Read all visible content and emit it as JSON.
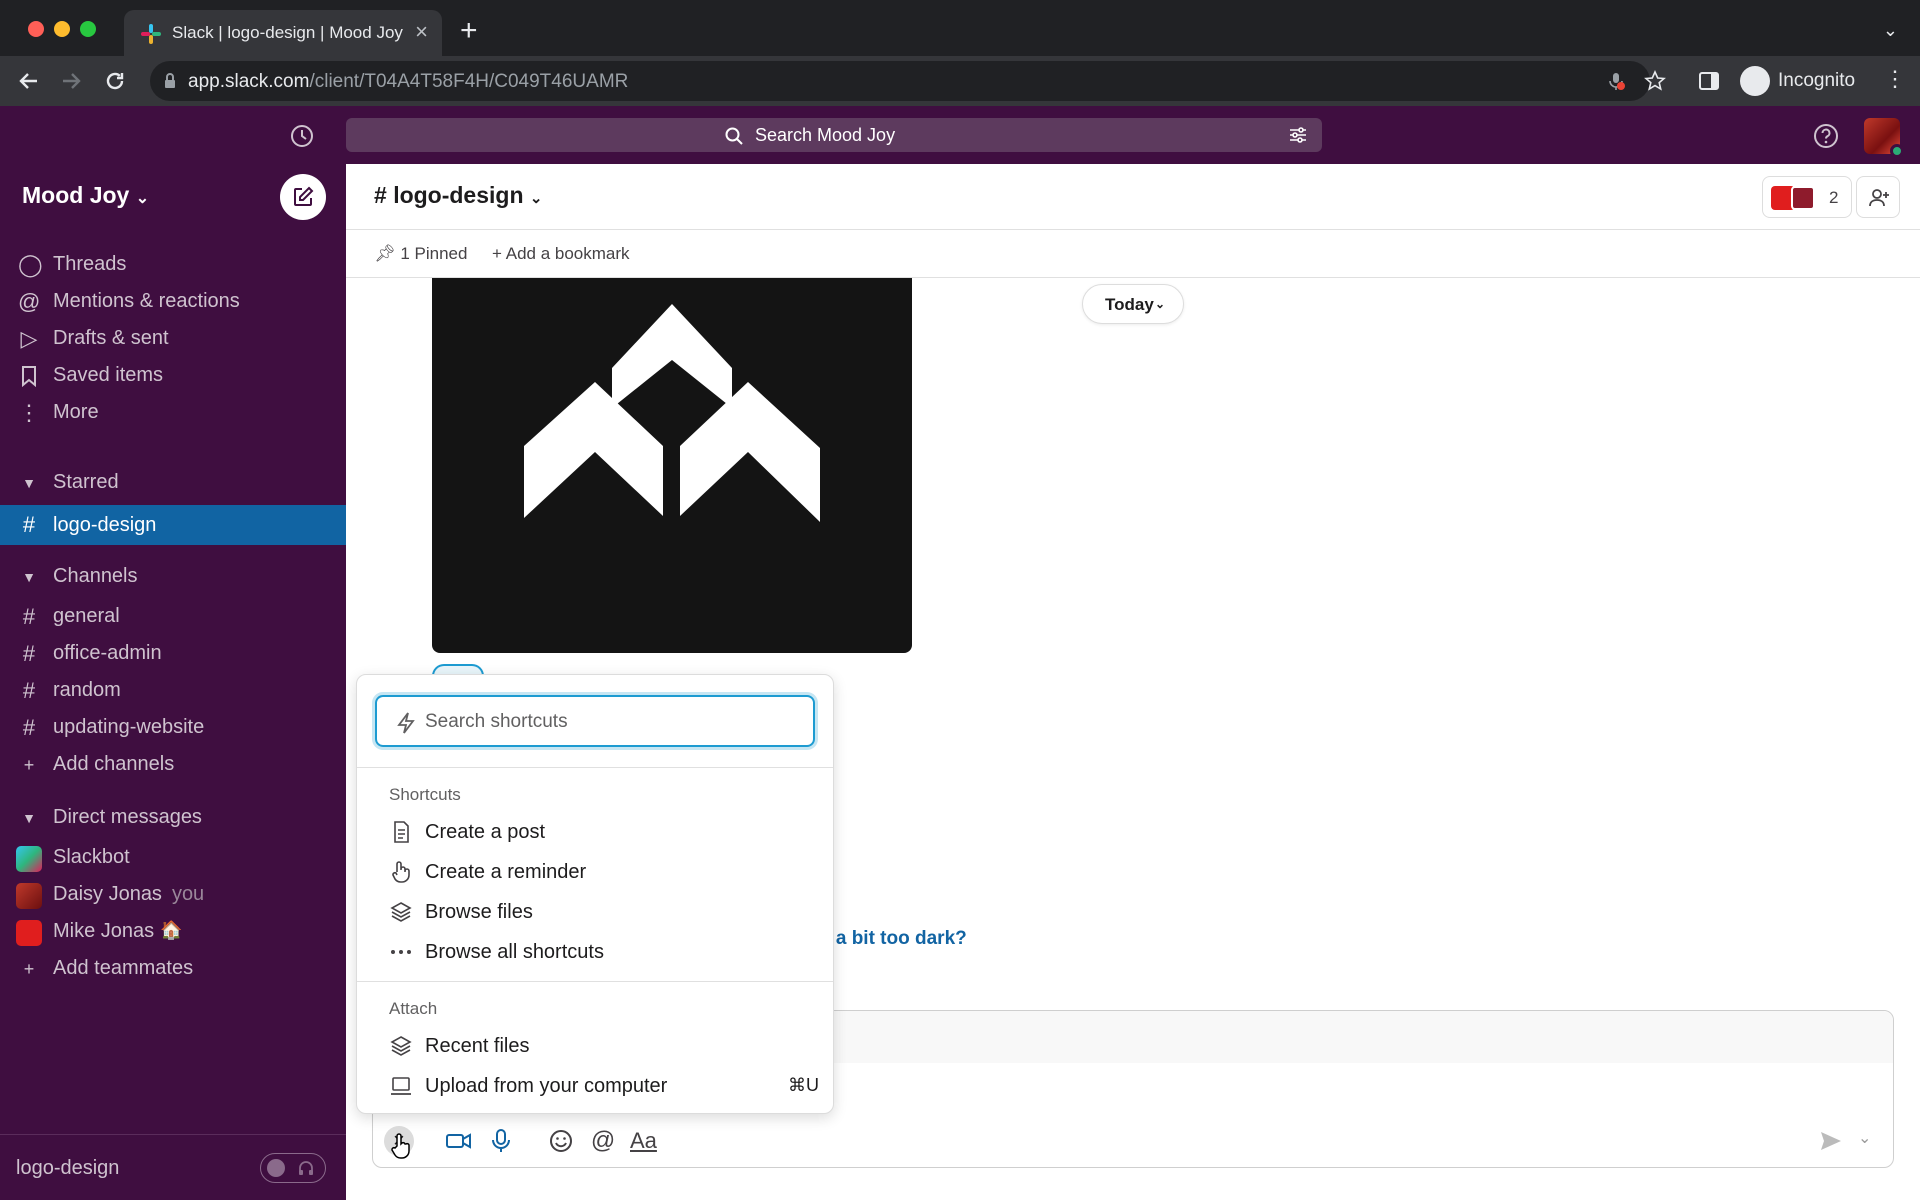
{
  "browser": {
    "tab_title": "Slack | logo-design | Mood Joy",
    "url_host": "app.slack.com",
    "url_path": "/client/T04A4T58F4H/C049T46UAMR",
    "profile_label": "Incognito"
  },
  "topbar": {
    "search_placeholder": "Search Mood Joy"
  },
  "sidebar": {
    "workspace_name": "Mood Joy",
    "nav": [
      {
        "label": "Threads",
        "icon": "threads-icon"
      },
      {
        "label": "Mentions & reactions",
        "icon": "at-icon"
      },
      {
        "label": "Drafts & sent",
        "icon": "send-icon"
      },
      {
        "label": "Saved items",
        "icon": "bookmark-icon"
      },
      {
        "label": "More",
        "icon": "more-vertical-icon"
      }
    ],
    "starred_header": "Starred",
    "starred": [
      {
        "label": "logo-design",
        "active": true
      }
    ],
    "channels_header": "Channels",
    "channels": [
      "general",
      "office-admin",
      "random",
      "updating-website"
    ],
    "add_channels": "Add channels",
    "dm_header": "Direct messages",
    "dms": [
      {
        "label": "Slackbot"
      },
      {
        "label": "Daisy Jonas",
        "suffix": "you"
      },
      {
        "label": "Mike Jonas"
      }
    ],
    "add_teammates": "Add teammates",
    "footer_channel": "logo-design"
  },
  "channel": {
    "name": "logo-design",
    "member_count": "2",
    "pinned_label": "1 Pinned",
    "add_bookmark_label": "Add a bookmark"
  },
  "messages": {
    "date_divider": "Today",
    "partial_link_text": "e a bit too dark?"
  },
  "shortcuts_menu": {
    "search_placeholder": "Search shortcuts",
    "shortcuts_header": "Shortcuts",
    "shortcuts": [
      {
        "label": "Create a post",
        "icon": "document-icon"
      },
      {
        "label": "Create a reminder",
        "icon": "reminder-hand-icon"
      },
      {
        "label": "Browse files",
        "icon": "layers-icon"
      },
      {
        "label": "Browse all shortcuts",
        "icon": "ellipsis-icon"
      }
    ],
    "attach_header": "Attach",
    "attach": [
      {
        "label": "Recent files",
        "icon": "layers-icon",
        "kbd": ""
      },
      {
        "label": "Upload from your computer",
        "icon": "laptop-icon",
        "kbd": "⌘U"
      }
    ]
  },
  "colors": {
    "aubergine": "#3f0e40",
    "active_channel": "#1164a3",
    "focus_blue": "#1d9bd1",
    "link_blue": "#1264a3"
  }
}
